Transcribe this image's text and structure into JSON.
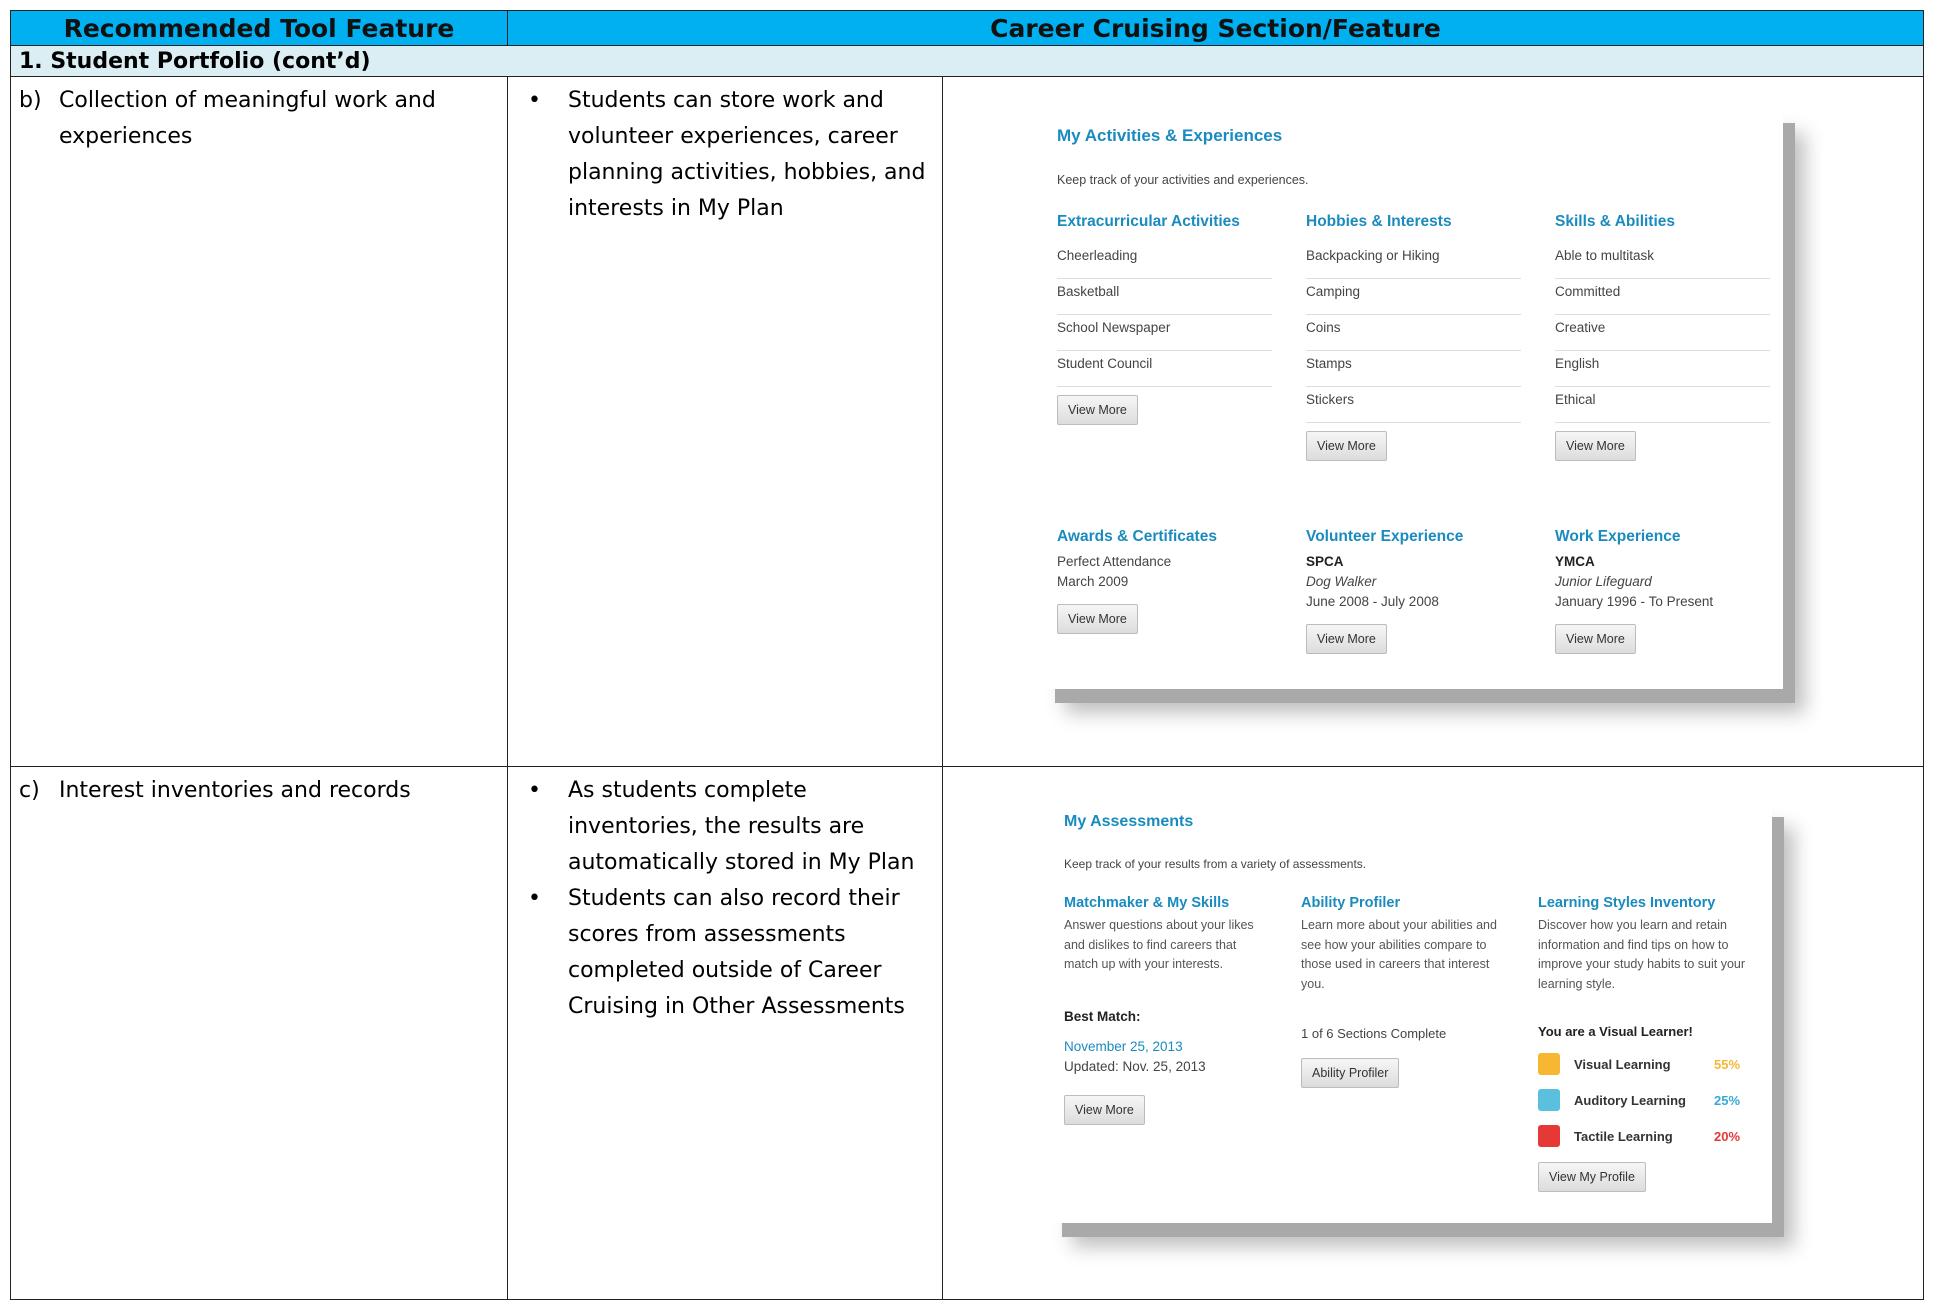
{
  "table": {
    "col1_header": "Recommended Tool Feature",
    "col2_header": "Career Cruising Section/Feature",
    "section_title": "1.  Student Portfolio (cont’d)"
  },
  "rows": [
    {
      "label": "b)",
      "feature": "Collection of meaningful work and experiences",
      "bullets": [
        "Students can store work and volunteer experiences, career planning activities, hobbies, and interests in My Plan"
      ]
    },
    {
      "label": "c)",
      "feature": "Interest inventories and records",
      "bullets": [
        "As students complete inventories, the results are automatically stored in My Plan",
        "Students can also record their scores from assessments completed outside of Career Cruising in Other Assessments"
      ]
    }
  ],
  "activities": {
    "title": "My Activities & Experiences",
    "subtitle": "Keep track of your activities and experiences.",
    "extracurricular": {
      "heading": "Extracurricular Activities",
      "items": [
        "Cheerleading",
        "Basketball",
        "School Newspaper",
        "Student Council"
      ],
      "button": "View More"
    },
    "hobbies": {
      "heading": "Hobbies & Interests",
      "items": [
        "Backpacking or Hiking",
        "Camping",
        "Coins",
        "Stamps",
        "Stickers"
      ],
      "button": "View More"
    },
    "skills": {
      "heading": "Skills & Abilities",
      "items": [
        "Able to multitask",
        "Committed",
        "Creative",
        "English",
        "Ethical"
      ],
      "button": "View More"
    },
    "awards": {
      "heading": "Awards & Certificates",
      "name": "Perfect Attendance",
      "date": "March 2009",
      "button": "View More"
    },
    "volunteer": {
      "heading": "Volunteer Experience",
      "org": "SPCA",
      "role": "Dog Walker",
      "dates": "June 2008 - July 2008",
      "button": "View More"
    },
    "work": {
      "heading": "Work Experience",
      "org": "YMCA",
      "role": "Junior Lifeguard",
      "dates": "January 1996 - To Present",
      "button": "View More"
    }
  },
  "assessments": {
    "title": "My Assessments",
    "subtitle": "Keep track of your results from a variety of assessments.",
    "matchmaker": {
      "heading": "Matchmaker & My Skills",
      "desc": "Answer questions about your likes and dislikes to find careers that match up with your interests.",
      "best_match_label": "Best Match:",
      "date": "November 25, 2013",
      "updated": "Updated: Nov. 25, 2013",
      "button": "View More"
    },
    "ability": {
      "heading": "Ability Profiler",
      "desc": "Learn more about your abilities and see how your abilities compare to those used in careers that interest you.",
      "progress": "1 of 6 Sections Complete",
      "button": "Ability Profiler"
    },
    "learning": {
      "heading": "Learning Styles Inventory",
      "desc": "Discover how you learn and retain information and find tips on how to improve your study habits to suit your learning style.",
      "result": "You are a Visual Learner!",
      "styles": [
        {
          "name": "Visual Learning",
          "pct": "55%",
          "color": "#f7b733"
        },
        {
          "name": "Auditory Learning",
          "pct": "25%",
          "color": "#5bc0de"
        },
        {
          "name": "Tactile Learning",
          "pct": "20%",
          "color": "#e53935"
        }
      ],
      "button": "View My Profile"
    }
  }
}
